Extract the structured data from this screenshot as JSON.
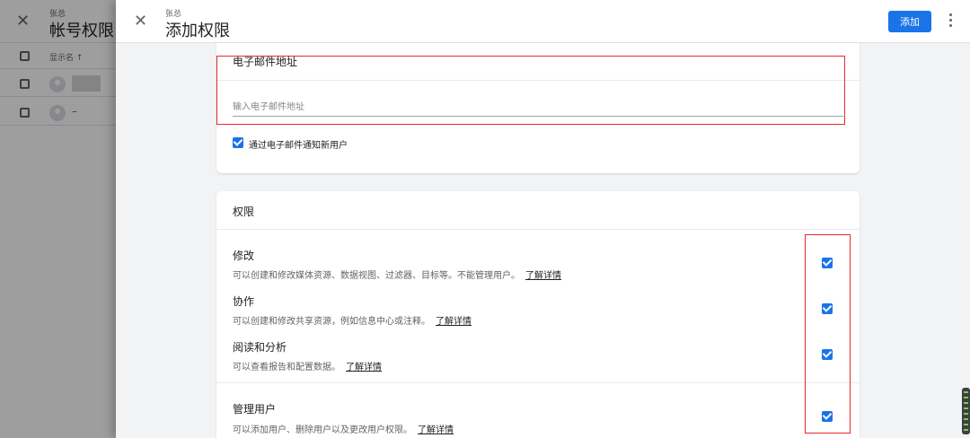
{
  "background": {
    "subtitle": "张总",
    "title": "帐号权限",
    "column_header": "显示名 ↑",
    "row2_text": "–"
  },
  "panel": {
    "subtitle": "张总",
    "title": "添加权限",
    "add_button": "添加",
    "close_icon": "×"
  },
  "email_section": {
    "label": "电子邮件地址",
    "placeholder": "输入电子邮件地址",
    "value": "",
    "notify_label": "通过电子邮件通知新用户",
    "notify_checked": true
  },
  "permissions": {
    "label": "权限",
    "learn_more": "了解详情",
    "items": [
      {
        "title": "修改",
        "desc": "可以创建和修改媒体资源、数据视图、过滤器、目标等。不能管理用户。",
        "checked": true
      },
      {
        "title": "协作",
        "desc": "可以创建和修改共享资源，例如信息中心或注释。",
        "checked": true
      },
      {
        "title": "阅读和分析",
        "desc": "可以查看报告和配置数据。",
        "checked": true
      },
      {
        "title": "管理用户",
        "desc": "可以添加用户、删除用户以及更改用户权限。",
        "checked": true
      }
    ]
  },
  "colors": {
    "accent": "#1a73e8",
    "highlight": "#e8282e"
  }
}
